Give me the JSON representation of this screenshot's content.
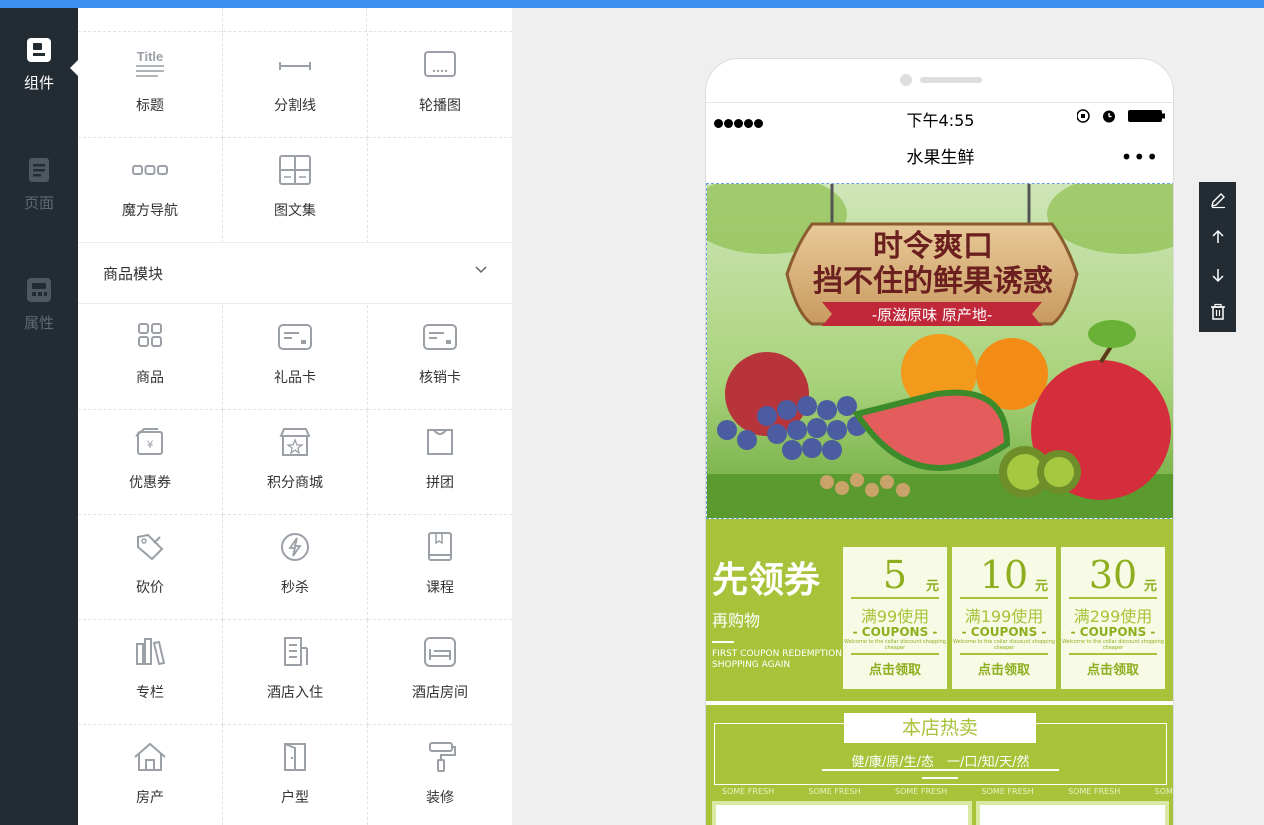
{
  "nav": {
    "items": [
      {
        "label": "组件",
        "icon": "component-icon",
        "active": true
      },
      {
        "label": "页面",
        "icon": "page-icon",
        "active": false
      },
      {
        "label": "属性",
        "icon": "property-icon",
        "active": false
      }
    ]
  },
  "panel": {
    "basic": [
      {
        "label": "标题",
        "icon": "title-icon"
      },
      {
        "label": "分割线",
        "icon": "divider-icon"
      },
      {
        "label": "轮播图",
        "icon": "carousel-icon"
      },
      {
        "label": "魔方导航",
        "icon": "cube-nav-icon"
      },
      {
        "label": "图文集",
        "icon": "gallery-icon"
      }
    ],
    "section_title": "商品模块",
    "goods": [
      {
        "label": "商品",
        "icon": "goods-icon"
      },
      {
        "label": "礼品卡",
        "icon": "gift-card-icon"
      },
      {
        "label": "核销卡",
        "icon": "verify-card-icon"
      },
      {
        "label": "优惠券",
        "icon": "coupon-icon"
      },
      {
        "label": "积分商城",
        "icon": "points-mall-icon"
      },
      {
        "label": "拼团",
        "icon": "group-buy-icon"
      },
      {
        "label": "砍价",
        "icon": "bargain-icon"
      },
      {
        "label": "秒杀",
        "icon": "flash-sale-icon"
      },
      {
        "label": "课程",
        "icon": "course-icon"
      },
      {
        "label": "专栏",
        "icon": "column-icon"
      },
      {
        "label": "酒店入住",
        "icon": "hotel-checkin-icon"
      },
      {
        "label": "酒店房间",
        "icon": "hotel-room-icon"
      },
      {
        "label": "房产",
        "icon": "house-icon"
      },
      {
        "label": "户型",
        "icon": "floor-plan-icon"
      },
      {
        "label": "装修",
        "icon": "paint-roller-icon"
      }
    ]
  },
  "phone": {
    "time": "下午4:55",
    "title": "水果生鲜",
    "more": "•••",
    "banner": {
      "line1": "时令爽口",
      "line2": "挡不住的鲜果诱惑",
      "ribbon": "-原滋原味 原产地-"
    },
    "coupon_section": {
      "title": "先领券",
      "subtitle": "再购物",
      "english_line1": "FIRST COUPON REDEMPTION",
      "english_line2": "SHOPPING AGAIN",
      "coupons": [
        {
          "amount": "5",
          "unit": "元",
          "condition": "满99使用",
          "label": "- COUPONS -",
          "small": "Welcome to the collar discount shopping cheaper",
          "action": "点击领取"
        },
        {
          "amount": "10",
          "unit": "元",
          "condition": "满199使用",
          "label": "- COUPONS -",
          "small": "Welcome to the collar discount shopping cheaper",
          "action": "点击领取"
        },
        {
          "amount": "30",
          "unit": "元",
          "condition": "满299使用",
          "label": "- COUPONS -",
          "small": "Welcome to the collar discount shopping cheaper",
          "action": "点击领取"
        }
      ]
    },
    "hot_section": {
      "title": "本店热卖",
      "subtitle": "健/康/原/生/态　一/口/知/天/然",
      "fresh_words": [
        "SOME FRESH",
        "SOME FRESH",
        "SOME FRESH",
        "SOME FRESH",
        "SOME FRESH",
        "SOME FRESH"
      ]
    }
  },
  "tools": [
    {
      "name": "edit-tool",
      "icon": "pencil-icon"
    },
    {
      "name": "move-up-tool",
      "icon": "arrow-up-icon"
    },
    {
      "name": "move-down-tool",
      "icon": "arrow-down-icon"
    },
    {
      "name": "delete-tool",
      "icon": "trash-icon"
    }
  ],
  "colors": {
    "accent": "#3d8ff0",
    "nav_bg": "#232b33",
    "fruit_green": "#a8c33a"
  }
}
